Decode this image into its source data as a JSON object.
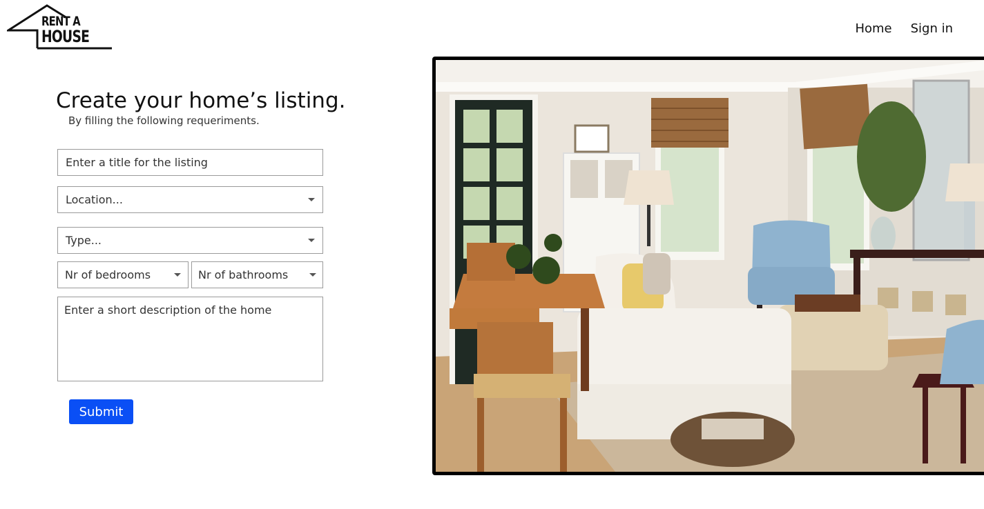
{
  "logo": {
    "line1": "RENT A",
    "line2": "HOUSE"
  },
  "nav": {
    "home": "Home",
    "sign_in": "Sign in"
  },
  "form": {
    "title": "Create your home’s listing.",
    "subtitle": "By filling the following requeriments.",
    "title_placeholder": "Enter a title for the listing",
    "location_placeholder": "Location...",
    "type_placeholder": "Type...",
    "bedrooms_placeholder": "Nr of bedrooms",
    "bathrooms_placeholder": "Nr of bathrooms",
    "description_placeholder": "Enter a short description of the home",
    "submit_label": "Submit"
  },
  "colors": {
    "accent": "#0a4ff5",
    "border": "#9a9a9a",
    "text": "#111111"
  }
}
